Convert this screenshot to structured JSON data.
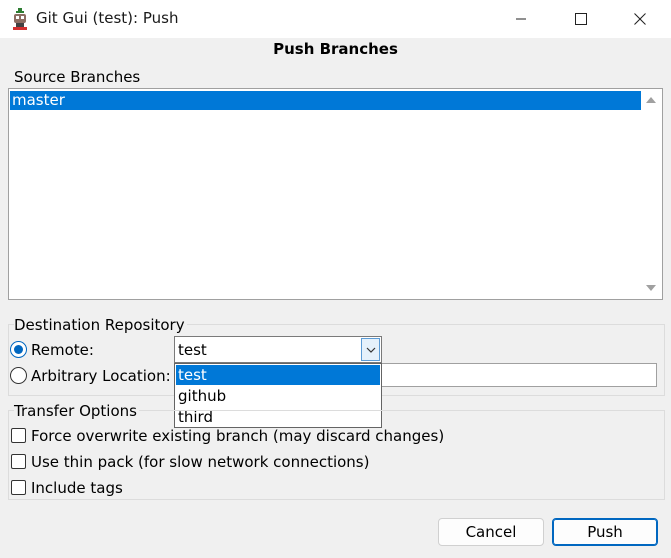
{
  "window": {
    "title": "Git Gui (test): Push",
    "icon": "git-gui-app-icon",
    "controls": [
      "minimize-icon",
      "maximize-icon",
      "close-icon"
    ]
  },
  "dialog": {
    "heading": "Push Branches"
  },
  "source_branches": {
    "label": "Source Branches",
    "items": [
      {
        "label": "master",
        "selected": true
      }
    ]
  },
  "destination": {
    "label": "Destination Repository",
    "remote_label": "Remote:",
    "remote_selected": true,
    "remote_value": "test",
    "remote_options": [
      {
        "label": "test",
        "highlighted": true
      },
      {
        "label": "github",
        "highlighted": false
      },
      {
        "label": "third",
        "highlighted": false
      }
    ],
    "arbitrary_label": "Arbitrary Location:",
    "arbitrary_value": ""
  },
  "transfer": {
    "label": "Transfer Options",
    "options": [
      {
        "label": "Force overwrite existing branch (may discard changes)",
        "checked": false
      },
      {
        "label": "Use thin pack (for slow network connections)",
        "checked": false
      },
      {
        "label": "Include tags",
        "checked": false
      }
    ]
  },
  "buttons": {
    "cancel": "Cancel",
    "push": "Push"
  },
  "colors": {
    "selection": "#0078d7",
    "accent": "#0067c0",
    "background": "#f0f0f0"
  }
}
